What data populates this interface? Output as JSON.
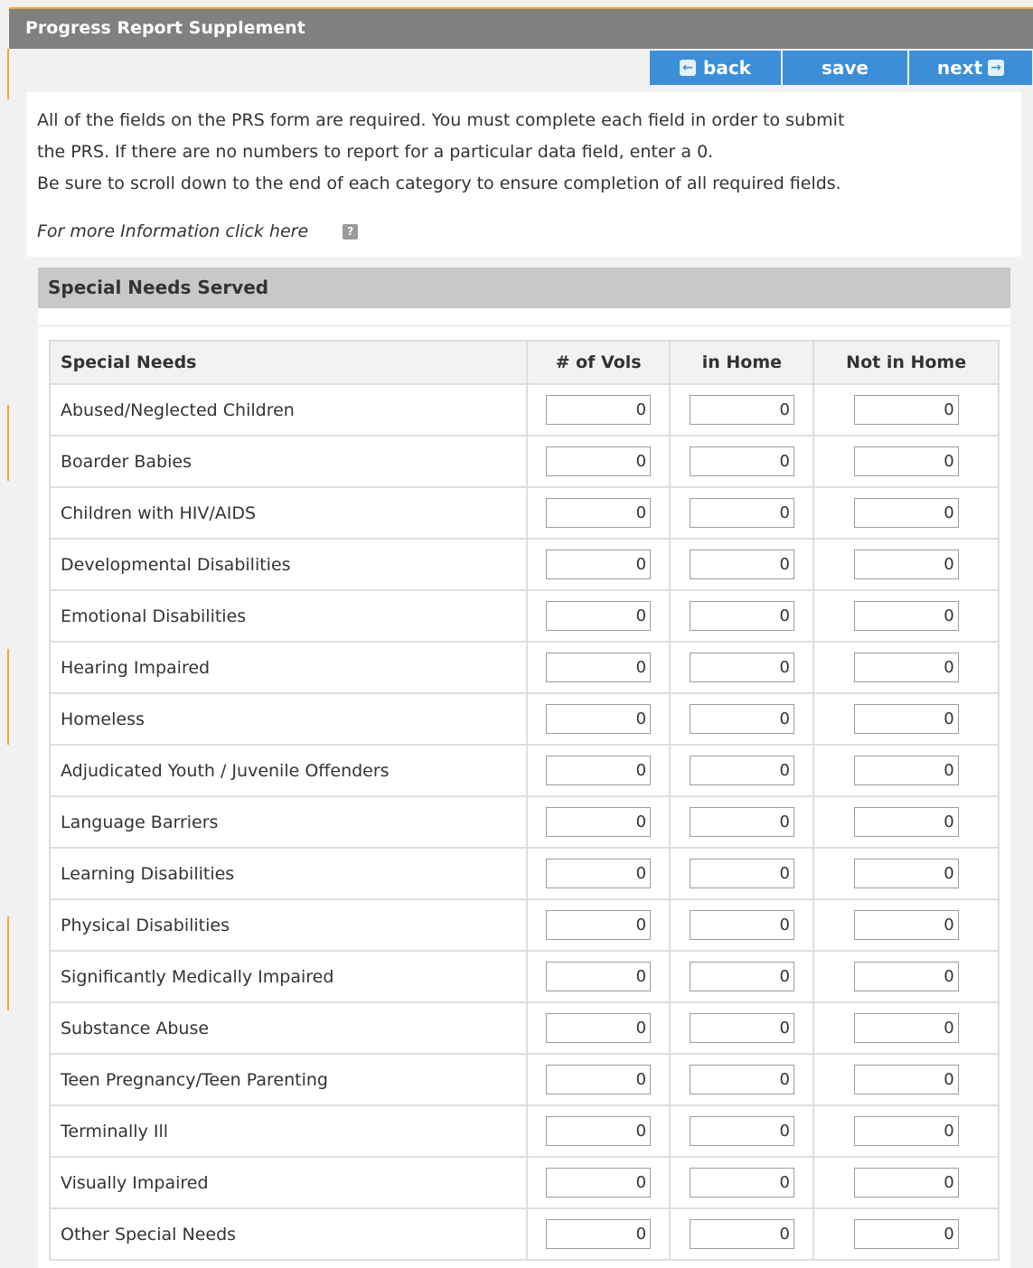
{
  "title": "Progress Report Supplement",
  "nav": {
    "back_label": "back",
    "save_label": "save",
    "next_label": "next",
    "back_icon": "arrow-left-icon",
    "next_icon": "arrow-right-icon"
  },
  "info": {
    "line1": "All of the fields on the PRS form are required. You must complete each field in order to submit",
    "line2": "the PRS. If there are no numbers to report for a particular data field, enter a 0.",
    "line3": "Be sure to scroll down to the end of each category to ensure completion of all required fields.",
    "more_link": "For more Information click here",
    "help_icon_glyph": "?"
  },
  "section": {
    "title": "Special Needs Served",
    "columns": [
      "Special Needs",
      "# of Vols",
      "in Home",
      "Not in Home"
    ],
    "rows": [
      {
        "label": "Abused/Neglected Children",
        "vols": "0",
        "in_home": "0",
        "not_in_home": "0"
      },
      {
        "label": "Boarder Babies",
        "vols": "0",
        "in_home": "0",
        "not_in_home": "0"
      },
      {
        "label": "Children with HIV/AIDS",
        "vols": "0",
        "in_home": "0",
        "not_in_home": "0"
      },
      {
        "label": "Developmental Disabilities",
        "vols": "0",
        "in_home": "0",
        "not_in_home": "0"
      },
      {
        "label": "Emotional Disabilities",
        "vols": "0",
        "in_home": "0",
        "not_in_home": "0"
      },
      {
        "label": "Hearing Impaired",
        "vols": "0",
        "in_home": "0",
        "not_in_home": "0"
      },
      {
        "label": "Homeless",
        "vols": "0",
        "in_home": "0",
        "not_in_home": "0"
      },
      {
        "label": "Adjudicated Youth / Juvenile Offenders",
        "vols": "0",
        "in_home": "0",
        "not_in_home": "0"
      },
      {
        "label": "Language Barriers",
        "vols": "0",
        "in_home": "0",
        "not_in_home": "0"
      },
      {
        "label": "Learning Disabilities",
        "vols": "0",
        "in_home": "0",
        "not_in_home": "0"
      },
      {
        "label": "Physical Disabilities",
        "vols": "0",
        "in_home": "0",
        "not_in_home": "0"
      },
      {
        "label": "Significantly Medically Impaired",
        "vols": "0",
        "in_home": "0",
        "not_in_home": "0"
      },
      {
        "label": "Substance Abuse",
        "vols": "0",
        "in_home": "0",
        "not_in_home": "0"
      },
      {
        "label": "Teen Pregnancy/Teen Parenting",
        "vols": "0",
        "in_home": "0",
        "not_in_home": "0"
      },
      {
        "label": "Terminally Ill",
        "vols": "0",
        "in_home": "0",
        "not_in_home": "0"
      },
      {
        "label": "Visually Impaired",
        "vols": "0",
        "in_home": "0",
        "not_in_home": "0"
      },
      {
        "label": "Other Special Needs",
        "vols": "0",
        "in_home": "0",
        "not_in_home": "0"
      }
    ]
  },
  "colors": {
    "title_bar": "#808080",
    "accent": "#f0a830",
    "nav_button": "#3b8fd8",
    "section_header": "#c8c8c8"
  }
}
